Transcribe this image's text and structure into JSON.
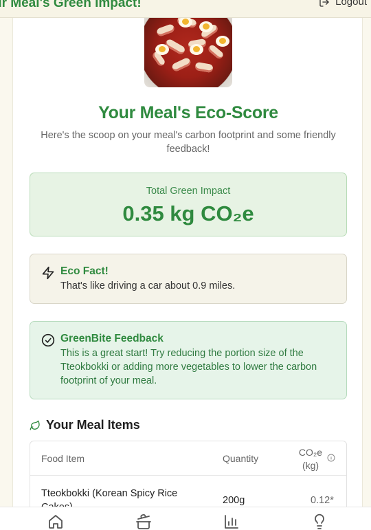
{
  "header": {
    "app_title": "ur Meal's Green Impact!",
    "logout_label": "Logout"
  },
  "eco": {
    "title": "Your Meal's Eco-Score",
    "subtitle": "Here's the scoop on your meal's carbon footprint and some friendly feedback!",
    "impact_label": "Total Green Impact",
    "impact_value": "0.35 kg CO₂e"
  },
  "fact": {
    "heading": "Eco Fact!",
    "text": "That's like driving a car about 0.9 miles.",
    "icon": "zap-icon"
  },
  "feedback": {
    "heading": "GreenBite Feedback",
    "text": "This is a great start! Try reducing the portion size of the Tteokbokki or adding more vegetables to lower the carbon footprint of your meal.",
    "icon": "check-circle-icon"
  },
  "items": {
    "heading": "Your Meal Items",
    "columns": {
      "food": "Food Item",
      "quantity": "Quantity",
      "co2": "CO₂e (kg)"
    },
    "rows": [
      {
        "food": "Tteokbokki (Korean Spicy Rice Cakes)",
        "quantity": "200g",
        "co2": "0.12*"
      }
    ]
  },
  "nav": [
    "home-icon",
    "cooking-pot-icon",
    "bar-chart-icon",
    "lightbulb-icon"
  ],
  "colors": {
    "accent": "#2f8a3f",
    "impact_bg": "#e7f3e4",
    "fact_bg": "#f5f3e9",
    "feedback_bg": "#e6f4e9",
    "page_bg": "#faf8ee"
  }
}
